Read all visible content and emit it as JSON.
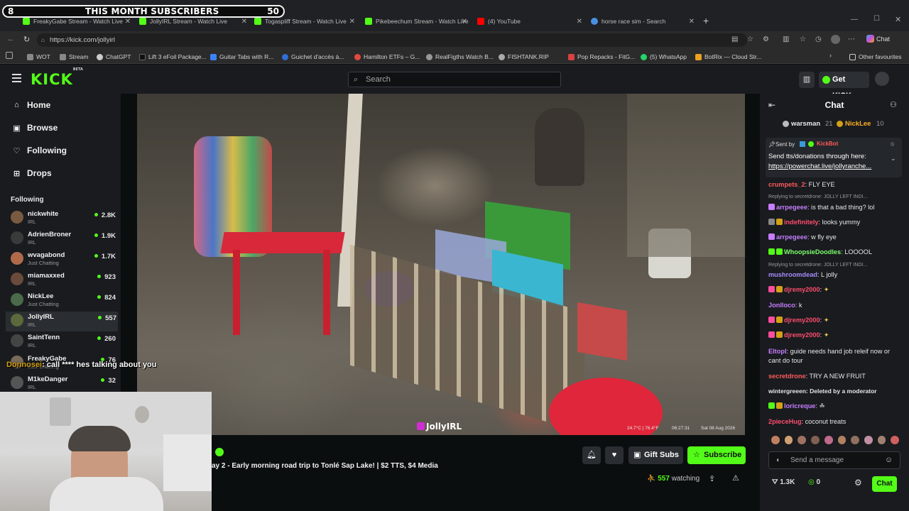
{
  "browser": {
    "tabs": [
      {
        "label": "FreakyGabe Stream - Watch Live",
        "color": "#53fc18"
      },
      {
        "label": "JollyIRL Stream - Watch Live",
        "color": "#53fc18"
      },
      {
        "label": "Togaspliff Stream - Watch Live",
        "color": "#53fc18"
      },
      {
        "label": "Pikebeechum Stream - Watch Live",
        "color": "#53fc18"
      },
      {
        "label": "(4) YouTube",
        "color": "#ff0000"
      },
      {
        "label": "horse race sim - Search",
        "color": "#4a90e2"
      }
    ],
    "url": "https://kick.com/jollyirl",
    "bookmarks": [
      {
        "label": "WOT",
        "color": "#888888"
      },
      {
        "label": "Stream",
        "color": "#888888"
      },
      {
        "label": "ChatGPT",
        "color": "#cccccc"
      },
      {
        "label": "Lift 3 eFoil Package...",
        "color": "#111111"
      },
      {
        "label": "Guitar Tabs with R...",
        "color": "#3b82f6"
      },
      {
        "label": "Guichet d'accès à...",
        "color": "#2f6fd6"
      },
      {
        "label": "Hamilton ETFs – G...",
        "color": "#e04a3f"
      },
      {
        "label": "RealFigths Watch B...",
        "color": "#999999"
      },
      {
        "label": "FISHTANK.RIP",
        "color": "#aaaaaa"
      },
      {
        "label": "Pop Repacks - FitG...",
        "color": "#d94242"
      },
      {
        "label": "(5) WhatsApp",
        "color": "#25d366"
      },
      {
        "label": "BotRix — Cloud Str...",
        "color": "#f0a020"
      }
    ],
    "other_favourites": "Other favourites",
    "profile_label": "Chat"
  },
  "subscriber_bar": {
    "current": "8",
    "title": "THIS MONTH SUBSCRIBERS",
    "goal": "50"
  },
  "header": {
    "logo": "KICK",
    "beta": "BETA",
    "search_placeholder": "Search",
    "get_kicks": "Get KICKs"
  },
  "sidebar": {
    "nav": [
      {
        "label": "Home",
        "icon": "home-icon"
      },
      {
        "label": "Browse",
        "icon": "browse-icon"
      },
      {
        "label": "Following",
        "icon": "heart-icon"
      },
      {
        "label": "Drops",
        "icon": "drops-icon"
      }
    ],
    "following_header": "Following",
    "channels": [
      {
        "name": "nickwhite",
        "category": "IRL",
        "viewers": "2.8K",
        "color": "#7a5a40"
      },
      {
        "name": "AdrienBroner",
        "category": "IRL",
        "viewers": "1.9K",
        "color": "#3a3a3a"
      },
      {
        "name": "wvagabond",
        "category": "Just Chatting",
        "viewers": "1.7K",
        "color": "#b06a4a"
      },
      {
        "name": "miamaxxed",
        "category": "IRL",
        "viewers": "923",
        "color": "#6a4a3a"
      },
      {
        "name": "NickLee",
        "category": "Just Chatting",
        "viewers": "824",
        "color": "#4a6a4a"
      },
      {
        "name": "JollyIRL",
        "category": "IRL",
        "viewers": "557",
        "color": "#5a6a3a"
      },
      {
        "name": "SaintTenn",
        "category": "IRL",
        "viewers": "260",
        "color": "#444444"
      },
      {
        "name": "FreakyGabe",
        "category": "Just Chatting",
        "viewers": "76",
        "color": "#7a6a5a"
      },
      {
        "name": "M1keDanger",
        "category": "IRL",
        "viewers": "32",
        "color": "#555555"
      }
    ]
  },
  "video": {
    "watermark": "JollyIRL",
    "temp": "24.7°C | 76.4°F",
    "time": "06:27:31",
    "date": "Sat 08 Aug 2026"
  },
  "overlay_chat": {
    "user": "Donnosei",
    "text": ": call **** hes talking about you"
  },
  "stream": {
    "title": "ay 2 - Early morning road trip to Tonlé Sap Lake! | $2 TTS, $4 Media",
    "gift_subs": "Gift Subs",
    "subscribe": "Subscribe",
    "watching_count": "557",
    "watching_label": "watching"
  },
  "chat": {
    "title": "Chat",
    "top_gifters": [
      {
        "name": "warsman",
        "count": "21"
      },
      {
        "name": "NickLee",
        "count": "10"
      }
    ],
    "pinned": {
      "sent_by": "Sent by",
      "bot": "KickBot",
      "text": "Send tts/donations through here:",
      "link": "https://powerchat.live/jollyranche..."
    },
    "messages": [
      {
        "user": "crumpets_2",
        "text": ": FLY EYE",
        "color": "#ff5a5a",
        "badge": ""
      },
      {
        "reply": "Replying to secretdrone: JOLLY LEFT INDI..."
      },
      {
        "user": "arrpegeee",
        "text": ": is that a bad thing? lol",
        "color": "#c77dff",
        "badge": "#c77dff"
      },
      {
        "user": "indefinitely",
        "text": ": looks yummy",
        "color": "#ff4d6d",
        "badge": "#888888"
      },
      {
        "user": "arrpegeee",
        "text": ": w fly eye",
        "color": "#c77dff",
        "badge": "#c77dff"
      },
      {
        "user": "WhoopsieDoodles",
        "text": ": LOOOOL",
        "color": "#7dff6a",
        "badge": "#53fc18"
      },
      {
        "reply": "Replying to secretdrone: JOLLY LEFT INDI..."
      },
      {
        "user": "mushroomdead",
        "text": ": L jolly",
        "color": "#a78bfa",
        "badge": ""
      },
      {
        "user": "djremy2000",
        "text": ":",
        "color": "#ff4d6d",
        "badge": "#ff4d9d"
      },
      {
        "user": "Jonlloco",
        "text": ": k",
        "color": "#c77dff",
        "badge": ""
      },
      {
        "user": "djremy2000",
        "text": ":",
        "color": "#ff4d6d",
        "badge": "#ff4d9d"
      },
      {
        "user": "djremy2000",
        "text": ":",
        "color": "#ff4d6d",
        "badge": "#ff4d9d"
      },
      {
        "user": "Eltopl",
        "text": ": guide needs hand job releif now or cant do tour",
        "color": "#c77dff",
        "badge": ""
      },
      {
        "user": "secretdrone",
        "text": ": TRY A NEW FRUIT",
        "color": "#ff5a5a",
        "badge": ""
      },
      {
        "user": "wintergreeen",
        "text": ": Deleted by a moderator",
        "color": "#e6e6e6",
        "badge": ""
      },
      {
        "user": "loricreque",
        "text": ":",
        "color": "#c77dff",
        "badge": "#53fc18"
      },
      {
        "user": "2pieceHug",
        "text": ": coconut treats",
        "color": "#ff4d6d",
        "badge": ""
      }
    ],
    "input_placeholder": "Send a message",
    "kicks_count": "1.3K",
    "points_count": "0",
    "chat_button": "Chat"
  }
}
